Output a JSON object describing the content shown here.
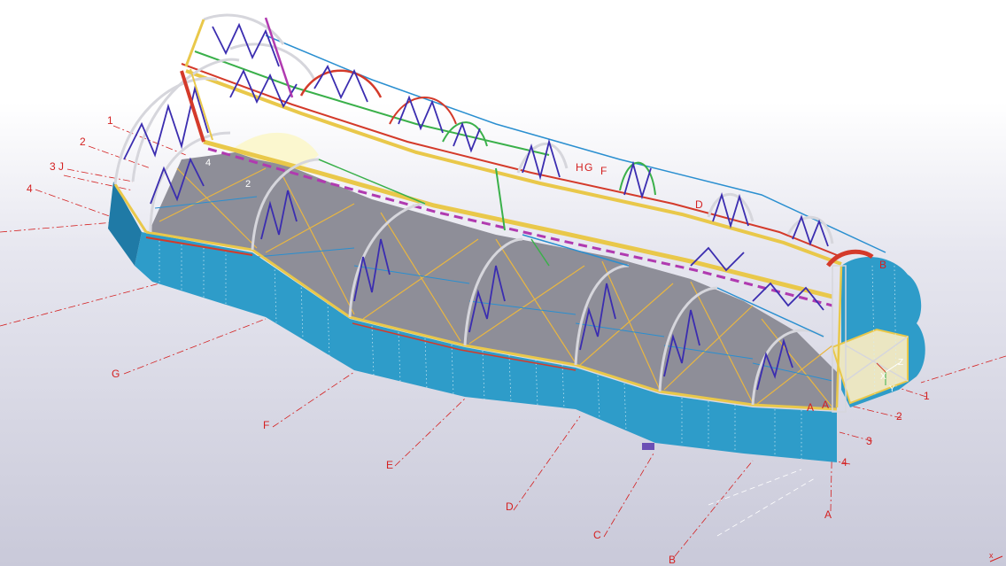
{
  "colors": {
    "cladding": "#2e9cc9",
    "cladding_dark": "#1f7aa6",
    "floor": "#8e8e98",
    "truss": "#d6d6dc",
    "bracing": "#3b2db0",
    "beam_yellow": "#e9c84a",
    "beam_red": "#d43a2a",
    "beam_green": "#3ab04a",
    "beam_magenta": "#b03ab0",
    "grid_line": "#d42020"
  },
  "grid_labels": {
    "left_numbers": [
      "1",
      "2",
      "3",
      "J",
      "4"
    ],
    "bottom_letters": [
      "G",
      "F",
      "E",
      "D",
      "C",
      "B",
      "A"
    ],
    "right_numbers": [
      "1",
      "2",
      "3",
      "4"
    ],
    "top_letters": [
      "H",
      "G",
      "F",
      "D",
      "B"
    ],
    "floor_markers": [
      "A",
      "A"
    ],
    "corner_mark": "x"
  },
  "part_labels": [
    "4",
    "2"
  ],
  "axis_labels": {
    "x": "X",
    "y": "Y",
    "z": "Z"
  }
}
